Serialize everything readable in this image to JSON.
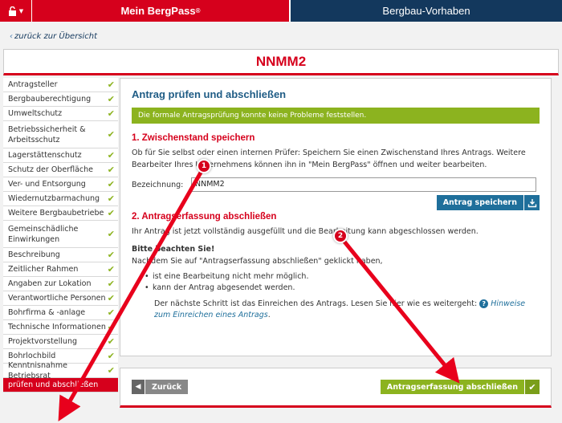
{
  "topbar": {
    "tab_bergpass": "Mein BergPass",
    "tab_bergpass_sup": "®",
    "tab_vorhaben": "Bergbau-Vorhaben"
  },
  "back_link": "zurück zur Übersicht",
  "project_title": "NNMM2",
  "sidebar": {
    "items": [
      {
        "label": "Antragsteller",
        "done": true
      },
      {
        "label": "Bergbauberechtigung",
        "done": true
      },
      {
        "label": "Umweltschutz",
        "done": true
      },
      {
        "label": "Betriebssicherheit & Arbeitsschutz",
        "done": true
      },
      {
        "label": "Lagerstättenschutz",
        "done": true
      },
      {
        "label": "Schutz der Oberfläche",
        "done": true
      },
      {
        "label": "Ver- und Entsorgung",
        "done": true
      },
      {
        "label": "Wiedernutzbarmachung",
        "done": true
      },
      {
        "label": "Weitere Bergbaubetriebe",
        "done": true
      },
      {
        "label": "Gemeinschädliche Einwirkungen",
        "done": true
      },
      {
        "label": "Beschreibung",
        "done": true
      },
      {
        "label": "Zeitlicher Rahmen",
        "done": true
      },
      {
        "label": "Angaben zur Lokation",
        "done": true
      },
      {
        "label": "Verantwortliche Personen",
        "done": true
      },
      {
        "label": "Bohrfirma & -anlage",
        "done": true
      },
      {
        "label": "Technische Informationen",
        "done": true
      },
      {
        "label": "Projektvorstellung",
        "done": true
      },
      {
        "label": "Bohrlochbild",
        "done": true
      },
      {
        "label": "Kenntnisnahme Betriebsrat",
        "done": true
      },
      {
        "label": "prüfen und abschließen",
        "done": false,
        "active": true
      }
    ]
  },
  "main": {
    "heading": "Antrag prüfen und abschließen",
    "success_msg": "Die formale Antragsprüfung konnte keine Probleme feststellen.",
    "section1_title": "1. Zwischenstand speichern",
    "section1_text": "Ob für Sie selbst oder einen internen Prüfer: Speichern Sie einen Zwischenstand Ihres Antrags. Weitere Bearbeiter Ihres Unternehmens können ihn in \"Mein BergPass\" öffnen und weiter bearbeiten.",
    "field_label": "Bezeichnung:",
    "field_value": "NNMM2",
    "save_button": "Antrag speichern",
    "section2_title": "2. Antragserfassung abschließen",
    "section2_text": "Ihr Antrag ist jetzt vollständig ausgefüllt und die Bearbeitung kann abgeschlossen werden.",
    "note_title": "Bitte beachten Sie!",
    "note_text": "Nachdem Sie auf \"Antragserfassung abschließen\" geklickt haben,",
    "bullets": [
      "ist eine Bearbeitung nicht mehr möglich.",
      "kann der Antrag abgesendet werden."
    ],
    "next_step_text": "Der nächste Schritt ist das Einreichen des Antrags. Lesen Sie hier wie es weitergeht:",
    "help_link": "Hinweise zum Einreichen eines Antrags",
    "help_link_suffix": "."
  },
  "footer": {
    "back_button": "Zurück",
    "finish_button": "Antragserfassung abschließen"
  },
  "annotations": {
    "badge1": "1",
    "badge2": "2",
    "arrow_color": "#e8001c"
  },
  "colors": {
    "brand_red": "#d6001c",
    "navy": "#13385d",
    "accent_green": "#8cb31f",
    "button_blue": "#1f6f9b"
  }
}
